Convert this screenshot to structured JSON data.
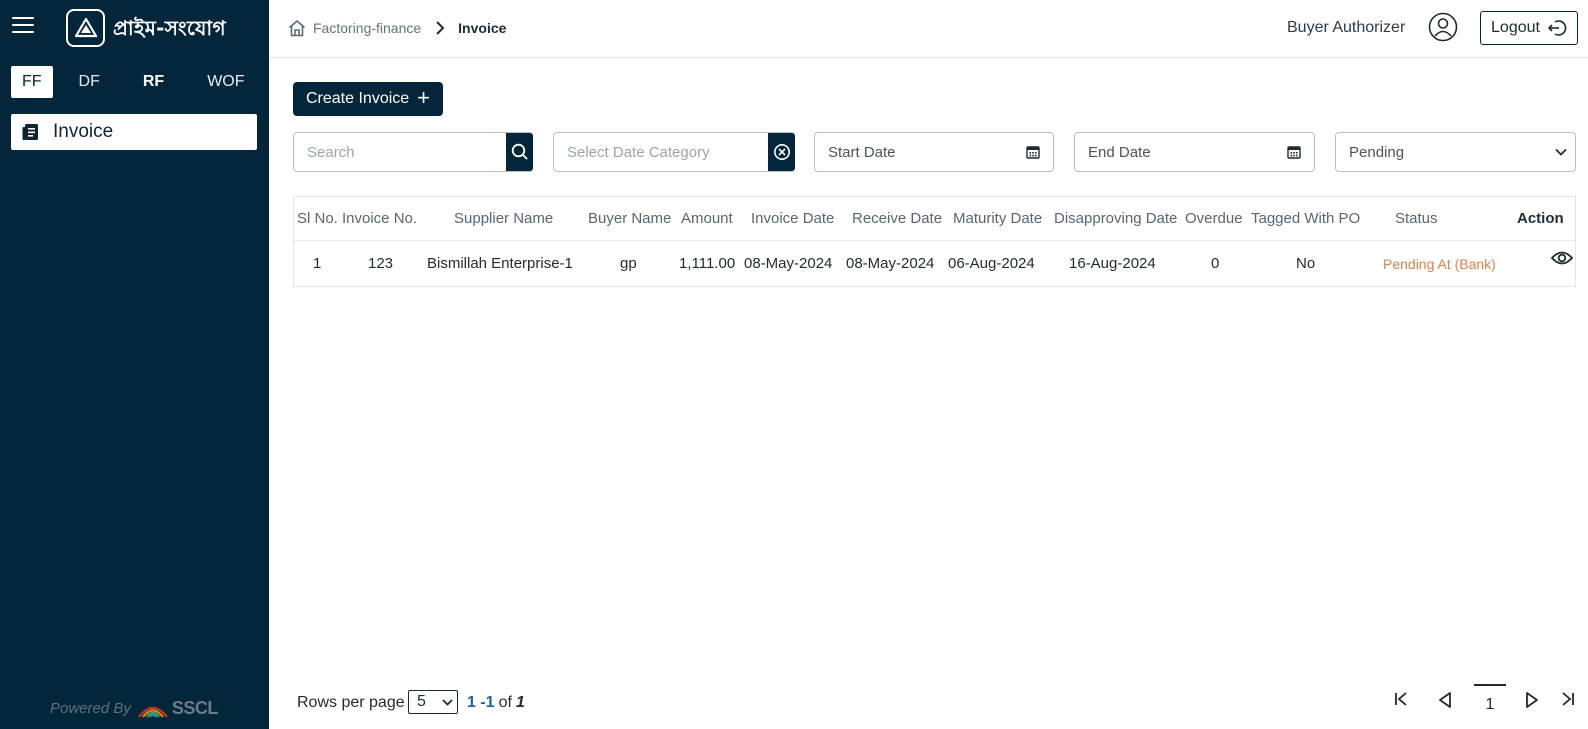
{
  "app": {
    "brand": "প্রাইম-সংযোগ",
    "powered_by": "Powered By",
    "powered_brand": "SSCL"
  },
  "sidebar": {
    "tabs": [
      {
        "label": "FF",
        "active": true
      },
      {
        "label": "DF",
        "active": false
      },
      {
        "label": "RF",
        "active": false
      },
      {
        "label": "WOF",
        "active": false
      }
    ],
    "nav": [
      {
        "label": "Invoice",
        "icon": "document-icon"
      }
    ]
  },
  "header": {
    "breadcrumb": {
      "root": "Factoring-finance",
      "current": "Invoice"
    },
    "user_role": "Buyer Authorizer",
    "logout_label": "Logout"
  },
  "toolbar": {
    "create_label": "Create Invoice"
  },
  "filters": {
    "search_placeholder": "Search",
    "date_category_placeholder": "Select Date Category",
    "start_date_placeholder": "Start Date",
    "end_date_placeholder": "End Date",
    "status_value": "Pending"
  },
  "table": {
    "headers": [
      "Sl No.",
      "Invoice No.",
      "Supplier Name",
      "Buyer Name",
      "Amount",
      "Invoice Date",
      "Receive Date",
      "Maturity Date",
      "Disapproving Date",
      "Overdue",
      "Tagged With PO",
      "Status",
      "Action"
    ],
    "rows": [
      {
        "sl": "1",
        "invoice_no": "123",
        "supplier": "Bismillah Enterprise-1",
        "buyer": "gp",
        "amount": "1,111.00",
        "invoice_date": "08-May-2024",
        "receive_date": "08-May-2024",
        "maturity_date": "06-Aug-2024",
        "disapproving_date": "16-Aug-2024",
        "overdue": "0",
        "tagged_po": "No",
        "status": "Pending At (Bank)"
      }
    ]
  },
  "pagination": {
    "rows_label": "Rows per page",
    "rows_value": "5",
    "range": "1 -1",
    "of_label": "of",
    "total": "1",
    "current_page": "1"
  },
  "colors": {
    "sidebar_bg": "#04263b",
    "status_pending": "#d9824b",
    "range_blue": "#1a64a8"
  }
}
